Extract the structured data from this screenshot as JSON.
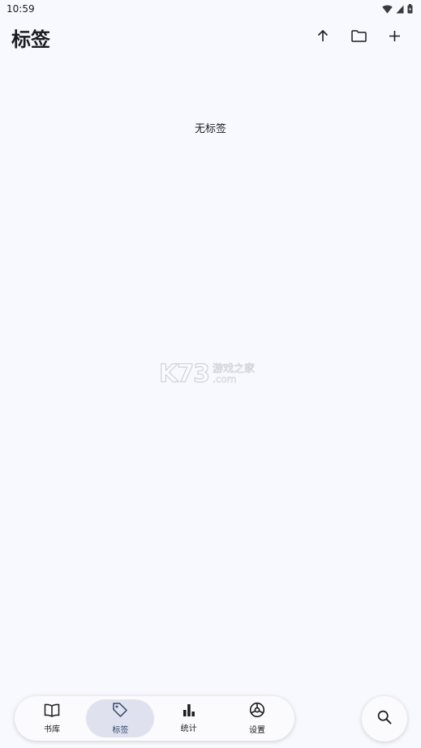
{
  "status_bar": {
    "time": "10:59"
  },
  "header": {
    "title": "标签"
  },
  "main": {
    "empty_text": "无标签"
  },
  "watermark": {
    "logo": "K73",
    "cn": "游戏之家",
    "com": ".com"
  },
  "bottom_nav": {
    "items": [
      {
        "label": "书库",
        "icon": "book-icon",
        "active": false
      },
      {
        "label": "标签",
        "icon": "tag-icon",
        "active": true
      },
      {
        "label": "统计",
        "icon": "bar-chart-icon",
        "active": false
      },
      {
        "label": "设置",
        "icon": "settings-icon",
        "active": false
      }
    ]
  },
  "colors": {
    "background": "#f8f9fe",
    "active_pill": "#dfe2ee",
    "active_text": "#30466d"
  }
}
